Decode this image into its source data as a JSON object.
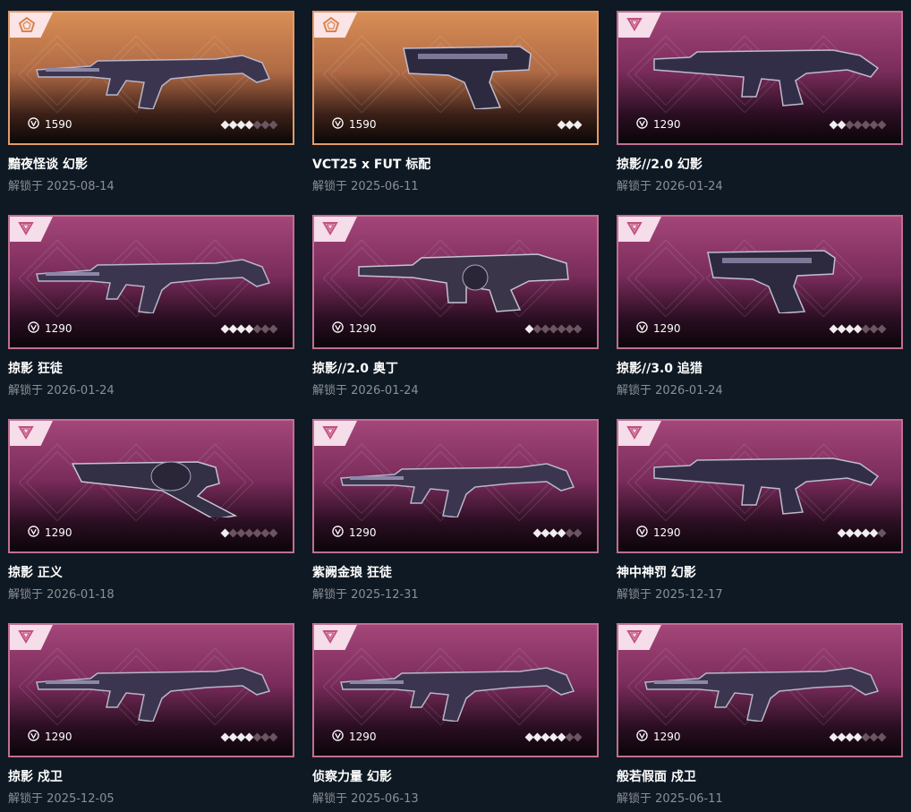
{
  "unlock_prefix": "解锁于",
  "colors": {
    "background": "#0f1923",
    "pink_border": "#c26e93",
    "orange_border": "#e29b6a",
    "date_text": "#8a8f96"
  },
  "skins": [
    {
      "name": "黯夜怪谈 幻影",
      "price": "1590",
      "tier": "orange",
      "rating": 4,
      "rating_max": 7,
      "date": "2025-08-14",
      "weapon_icon": "rifle-icon"
    },
    {
      "name": "VCT25 x FUT 标配",
      "price": "1590",
      "tier": "orange",
      "rating": 3,
      "rating_max": 3,
      "date": "2025-06-11",
      "weapon_icon": "pistol-icon"
    },
    {
      "name": "掠影//2.0 幻影",
      "price": "1290",
      "tier": "pink",
      "rating": 2,
      "rating_max": 7,
      "date": "2026-01-24",
      "weapon_icon": "smg-icon"
    },
    {
      "name": "掠影 狂徒",
      "price": "1290",
      "tier": "pink",
      "rating": 4,
      "rating_max": 7,
      "date": "2026-01-24",
      "weapon_icon": "rifle-icon"
    },
    {
      "name": "掠影//2.0 奥丁",
      "price": "1290",
      "tier": "pink",
      "rating": 1,
      "rating_max": 7,
      "date": "2026-01-24",
      "weapon_icon": "heavy-icon"
    },
    {
      "name": "掠影//3.0 追猎",
      "price": "1290",
      "tier": "pink",
      "rating": 4,
      "rating_max": 7,
      "date": "2026-01-24",
      "weapon_icon": "pistol-icon"
    },
    {
      "name": "掠影 正义",
      "price": "1290",
      "tier": "pink",
      "rating": 1,
      "rating_max": 7,
      "date": "2026-01-18",
      "weapon_icon": "revolver-icon"
    },
    {
      "name": "紫阙金琅 狂徒",
      "price": "1290",
      "tier": "pink",
      "rating": 4,
      "rating_max": 6,
      "date": "2025-12-31",
      "weapon_icon": "rifle-icon"
    },
    {
      "name": "神中神罚 幻影",
      "price": "1290",
      "tier": "pink",
      "rating": 5,
      "rating_max": 6,
      "date": "2025-12-17",
      "weapon_icon": "smg-icon"
    },
    {
      "name": "掠影 戍卫",
      "price": "1290",
      "tier": "pink",
      "rating": 4,
      "rating_max": 7,
      "date": "2025-12-05",
      "weapon_icon": "rifle-icon"
    },
    {
      "name": "侦察力量 幻影",
      "price": "1290",
      "tier": "pink",
      "rating": 5,
      "rating_max": 7,
      "date": "2025-06-13",
      "weapon_icon": "rifle-icon"
    },
    {
      "name": "般若假面 戍卫",
      "price": "1290",
      "tier": "pink",
      "rating": 4,
      "rating_max": 7,
      "date": "2025-06-11",
      "weapon_icon": "rifle-icon"
    }
  ]
}
